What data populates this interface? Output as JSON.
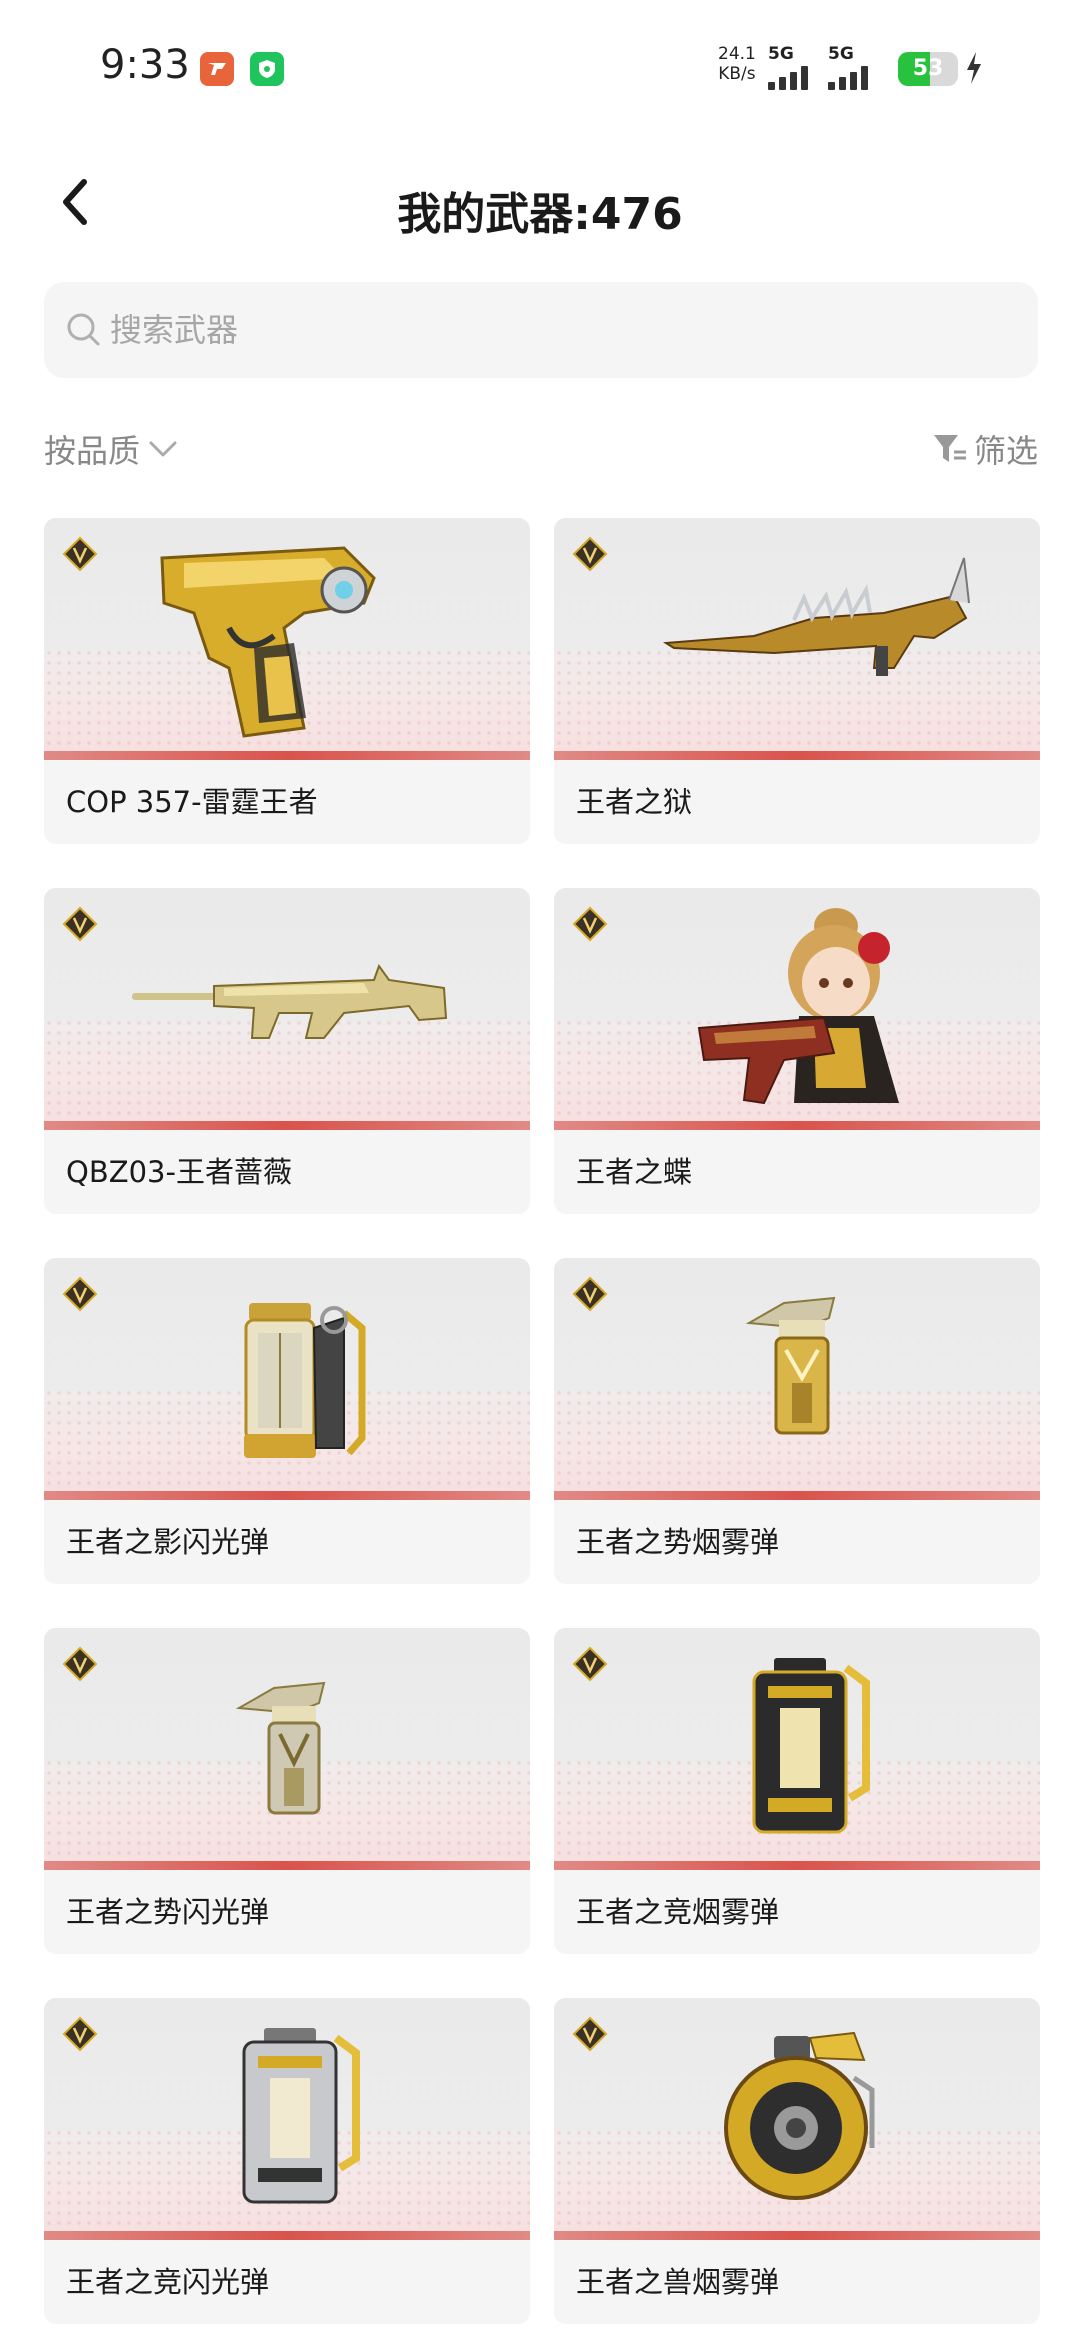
{
  "status_bar": {
    "time": "9:33",
    "net_speed_value": "24.1",
    "net_speed_unit": "KB/s",
    "sim1_label": "5G",
    "sim2_label": "5G",
    "battery_level": "53",
    "battery_color": "#29c23f",
    "icons": [
      "app-notification-icon",
      "shield-app-icon",
      "charging-bolt-icon"
    ]
  },
  "header": {
    "title": "我的武器:476"
  },
  "search": {
    "placeholder": "搜索武器"
  },
  "toolbar": {
    "sort_label": "按品质",
    "filter_label": "筛选"
  },
  "weapons": [
    {
      "name": "COP 357-雷霆王者",
      "art": "pistol"
    },
    {
      "name": "王者之狱",
      "art": "long-rifle"
    },
    {
      "name": "QBZ03-王者蔷薇",
      "art": "assault-rifle"
    },
    {
      "name": "王者之蝶",
      "art": "character-with-gun"
    },
    {
      "name": "王者之影闪光弹",
      "art": "flash-grenade"
    },
    {
      "name": "王者之势烟雾弹",
      "art": "smoke-grenade"
    },
    {
      "name": "王者之势闪光弹",
      "art": "flash-grenade-small"
    },
    {
      "name": "王者之竞烟雾弹",
      "art": "smoke-canister"
    },
    {
      "name": "王者之竞闪光弹",
      "art": "flash-canister"
    },
    {
      "name": "王者之兽烟雾弹",
      "art": "round-grenade"
    }
  ],
  "colors": {
    "accent_gold": "#d4a926",
    "card_bg": "#f5f5f5",
    "card_stripe": "#d9534c"
  }
}
